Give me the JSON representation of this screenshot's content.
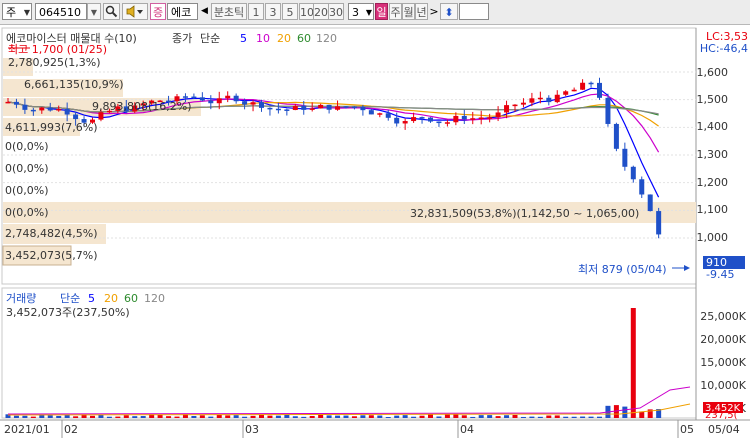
{
  "toolbar": {
    "market_select": "주",
    "code_input": "064510",
    "search_icon": "magnifier-icon",
    "speaker_icon": "speaker-icon",
    "badge": "증",
    "stock_short": "에코",
    "prev_arrow": "◀",
    "period_label": "분초틱",
    "intervals": [
      "1",
      "3",
      "5",
      "10",
      "20",
      "30"
    ],
    "interval_value": "3",
    "day_label": "일",
    "week_label": "주",
    "month_label": "월",
    "year_label": "년",
    "next_arrow": ">",
    "updown_icon": "updown-arrow-icon"
  },
  "price_panel": {
    "title": "에코마이스터 매물대 수(10)",
    "legend_close": "종가",
    "legend_ma": "단순",
    "ma_periods": [
      "5",
      "10",
      "20",
      "60",
      "120"
    ],
    "lc_label": "LC:3,53",
    "hc_label": "HC:-46,4",
    "high_annotation": "최고 1,700 (01/25)",
    "low_annotation": "최저 879 (05/04)",
    "current_price": "910",
    "change_pct": "-9.45",
    "y_ticks": [
      "1,600",
      "1,500",
      "1,400",
      "1,300",
      "1,200",
      "1,100",
      "1,000"
    ],
    "volume_profile": [
      "2,780,925(1,3%)",
      "6,661,135(10,9%)",
      "9,893,808(16,2%)",
      "4,611,993(7,6%)",
      "0(0,0%)",
      "0(0,0%)",
      "0(0,0%)",
      "0(0,0%)",
      "2,748,482(4,5%)",
      "3,452,073(5,7%)"
    ],
    "peak_band_label": "32,831,509(53,8%)(1,142,50 ~ 1,065,00)"
  },
  "volume_panel": {
    "title": "거래량",
    "legend_ma": "단순",
    "ma_periods": [
      "5",
      "20",
      "60",
      "120"
    ],
    "stat": "3,452,073주(237,50%)",
    "y_ticks": [
      "25,000K",
      "20,000K",
      "15,000K",
      "10,000K",
      "5,000K"
    ],
    "current_volume": "3,452K",
    "current_ratio": "237,5("
  },
  "x_axis": {
    "labels": [
      "2021/01",
      "02",
      "03",
      "04",
      "05",
      "05/04"
    ]
  },
  "colors": {
    "up": "#e8000e",
    "down": "#1f50c8",
    "ma5": "#0000ff",
    "ma10": "#cc00cc",
    "ma20": "#f0a000",
    "ma60": "#2e8b2e",
    "ma120": "#888888",
    "band": "#f5e6d0"
  }
}
